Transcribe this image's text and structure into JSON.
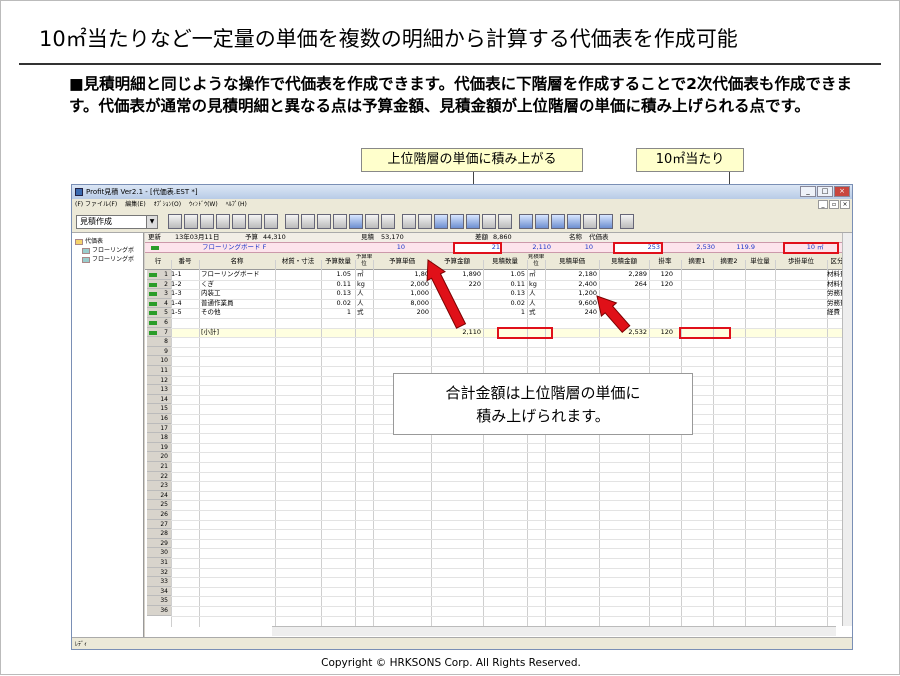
{
  "slide": {
    "title": "10㎡当たりなど一定量の単価を複数の明細から計算する代価表を作成可能",
    "body": "■見積明細と同じような操作で代価表を作成できます。代価表に下階層を作成することで2次代価表も作成できます。代価表が通常の見積明細と異なる点は予算金額、見積金額が上位階層の単価に積み上げられる点です。",
    "callouts": {
      "unit_price": "上位階層の単価に積み上がる",
      "per_10": "10㎡当たり",
      "total_line1": "合計金額は上位階層の単価に",
      "total_line2": "積み上げられます。"
    },
    "footer": "Copyright ©  HRKSONS Corp.   All Rights Reserved."
  },
  "app": {
    "window_title": "Profit見積 Ver2.1 - [代価表.EST *]",
    "menu": [
      "(F) ファイル(F)",
      "編集(E)",
      "ｵﾌﾟｼｮﾝ(O)",
      "ｳｨﾝﾄﾞｳ(W)",
      "ﾍﾙﾌﾟ(H)"
    ],
    "mode_dropdown": "見積作成",
    "status": "ﾚﾃﾞｨ",
    "tree": {
      "root": "代価表",
      "children": [
        "フローリングボ",
        "フローリングボ"
      ]
    },
    "info_row": {
      "updated_label": "更新",
      "date": "13年03月11日",
      "budget_label": "予算",
      "budget": "44,310",
      "estimate_label": "見積",
      "estimate": "53,170",
      "gross_label": "差額",
      "gross": "8,860",
      "name_label": "名称",
      "name": "代価表"
    },
    "parent_row": {
      "name": "フローリングボード F",
      "qty": "10",
      "budget_unit_price": "21",
      "budget_amount": "2,110",
      "est_qty": "10",
      "est_unit_price": "253",
      "est_amount": "2,530",
      "rate": "119.9",
      "per_unit_qty": "10",
      "per_unit": "㎡"
    },
    "columns": [
      "行",
      "番号",
      "名称",
      "材質・寸法",
      "予算数量",
      "予算単位",
      "予算単価",
      "予算金額",
      "見積数量",
      "見積単位",
      "見積単価",
      "見積金額",
      "掛率",
      "摘要1",
      "摘要2",
      "単位量",
      "歩掛単位",
      "区分"
    ],
    "rows": [
      {
        "no": "1",
        "code": "1-1",
        "name": "フローリングボード",
        "bq": "1.05",
        "bu": "㎡",
        "bp": "1,80",
        "ba": "1,890",
        "eq": "1.05",
        "eu": "㎡",
        "ep": "2,180",
        "ea": "2,289",
        "rate": "120",
        "cat": "材料費"
      },
      {
        "no": "2",
        "code": "1-2",
        "name": "くぎ",
        "bq": "0.11",
        "bu": "kg",
        "bp": "2,000",
        "ba": "220",
        "eq": "0.11",
        "eu": "kg",
        "ep": "2,400",
        "ea": "264",
        "rate": "120",
        "cat": "材料費"
      },
      {
        "no": "3",
        "code": "1-3",
        "name": "内装工",
        "bq": "0.13",
        "bu": "人",
        "bp": "1,000",
        "ba": "",
        "eq": "0.13",
        "eu": "人",
        "ep": "1,200",
        "ea": "",
        "rate": "",
        "cat": "労務費"
      },
      {
        "no": "4",
        "code": "1-4",
        "name": "普通作業員",
        "bq": "0.02",
        "bu": "人",
        "bp": "8,000",
        "ba": "",
        "eq": "0.02",
        "eu": "人",
        "ep": "9,600",
        "ea": "",
        "rate": "",
        "cat": "労務費"
      },
      {
        "no": "5",
        "code": "1-5",
        "name": "その他",
        "bq": "1",
        "bu": "式",
        "bp": "200",
        "ba": "",
        "eq": "1",
        "eu": "式",
        "ep": "240",
        "ea": "",
        "rate": "",
        "cat": "経費"
      },
      {
        "no": "6",
        "code": "",
        "name": "",
        "bq": "",
        "bu": "",
        "bp": "",
        "ba": "",
        "eq": "",
        "eu": "",
        "ep": "",
        "ea": "",
        "rate": "",
        "cat": ""
      },
      {
        "no": "7",
        "code": "",
        "name": "[小計]",
        "bq": "",
        "bu": "",
        "bp": "",
        "ba": "2,110",
        "eq": "",
        "eu": "",
        "ep": "",
        "ea": "2,532",
        "rate": "120",
        "cat": ""
      }
    ],
    "empty_rows": [
      "8",
      "9",
      "10",
      "11",
      "12",
      "13",
      "14",
      "15",
      "16",
      "17",
      "18",
      "19",
      "20",
      "21",
      "22",
      "23",
      "24",
      "25",
      "26",
      "27",
      "28",
      "29",
      "30",
      "31",
      "32",
      "33",
      "34",
      "35",
      "36"
    ]
  }
}
